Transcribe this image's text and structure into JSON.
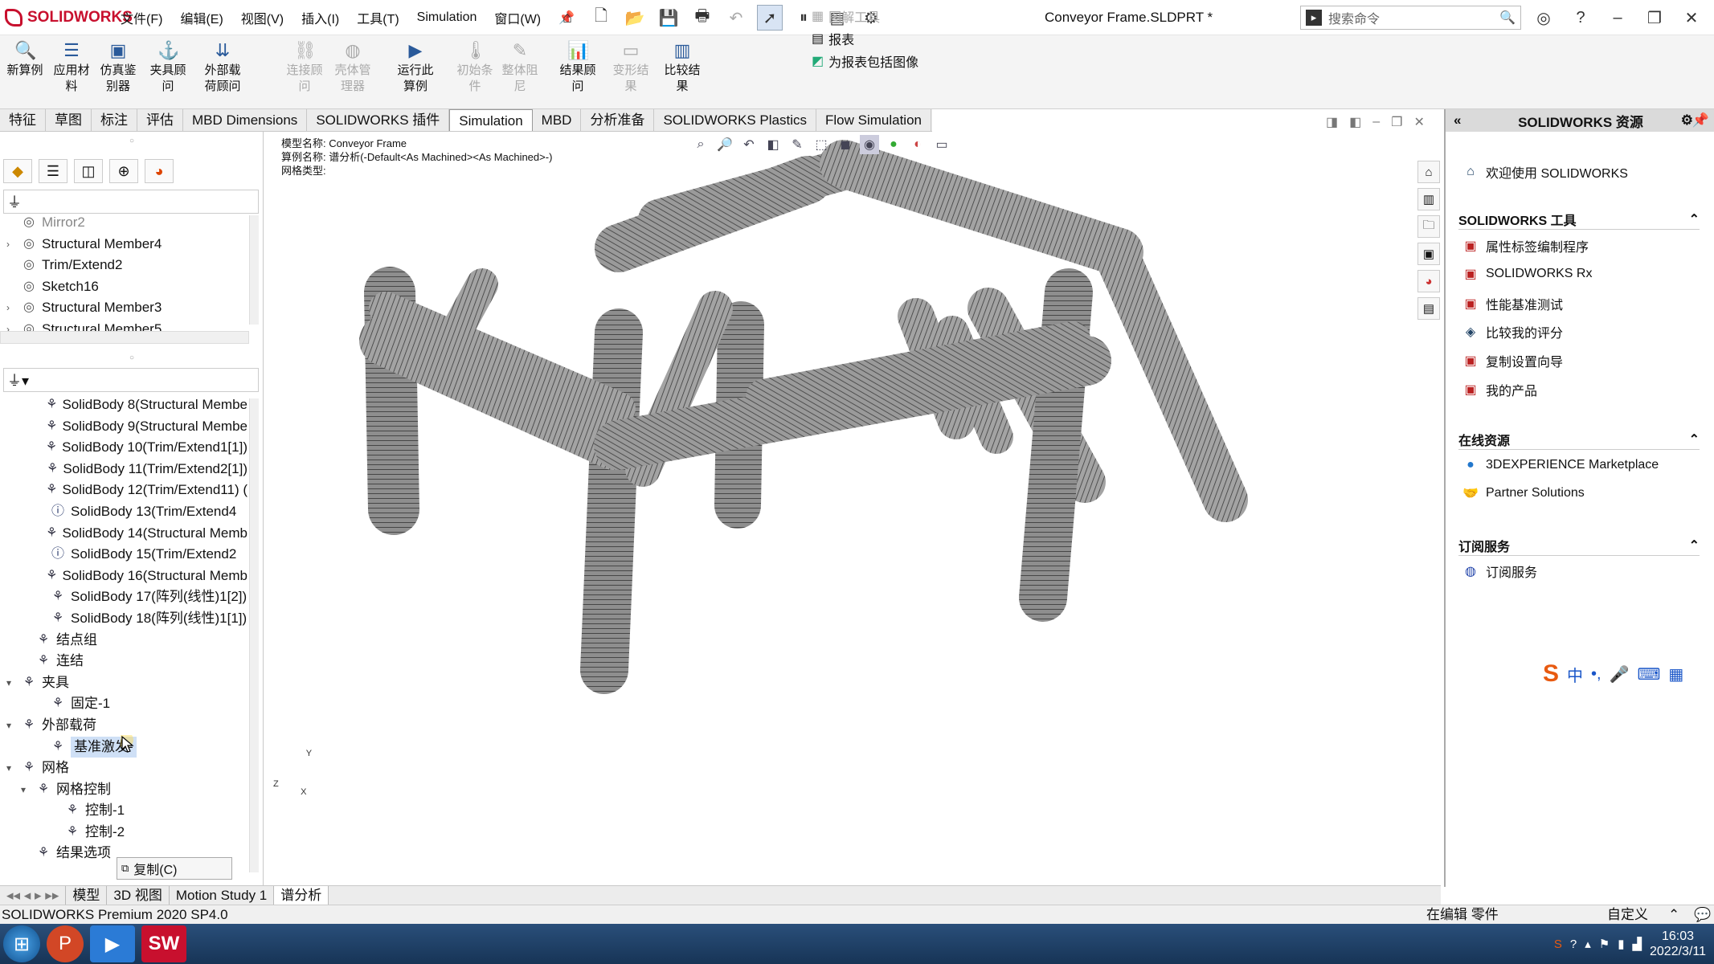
{
  "app": {
    "brand": "SOLIDWORKS",
    "doc_title": "Conveyor Frame.SLDPRT *"
  },
  "menu": [
    "文件(F)",
    "编辑(E)",
    "视图(V)",
    "插入(I)",
    "工具(T)",
    "Simulation",
    "窗口(W)"
  ],
  "search": {
    "placeholder": "搜索命令"
  },
  "ribbon": {
    "buttons": [
      {
        "label": "新算例",
        "icon": "study-icon",
        "enabled": true
      },
      {
        "label": "应用材料",
        "icon": "material-icon",
        "enabled": true
      },
      {
        "label": "仿真鉴别器",
        "icon": "evaluator-icon",
        "enabled": true
      },
      {
        "label": "夹具顾问",
        "icon": "fixture-icon",
        "enabled": true
      },
      {
        "label": "外部载荷顾问",
        "icon": "load-icon",
        "enabled": true
      },
      {
        "label": "连接顾问",
        "icon": "connection-icon",
        "enabled": false
      },
      {
        "label": "壳体管理器",
        "icon": "shell-icon",
        "enabled": false
      },
      {
        "label": "运行此算例",
        "icon": "run-icon",
        "enabled": true
      },
      {
        "label": "初始条件",
        "icon": "init-icon",
        "enabled": false
      },
      {
        "label": "整体阻尼",
        "icon": "damping-icon",
        "enabled": false
      },
      {
        "label": "结果顾问",
        "icon": "result-icon",
        "enabled": true
      },
      {
        "label": "变形结果",
        "icon": "deform-icon",
        "enabled": false
      },
      {
        "label": "比较结果",
        "icon": "compare-icon",
        "enabled": true
      }
    ],
    "small": [
      {
        "label": "图解工具",
        "enabled": false
      },
      {
        "label": "报表",
        "enabled": true
      },
      {
        "label": "为报表包括图像",
        "enabled": true
      }
    ]
  },
  "tabs": [
    "特征",
    "草图",
    "标注",
    "评估",
    "MBD Dimensions",
    "SOLIDWORKS 插件",
    "Simulation",
    "MBD",
    "分析准备",
    "SOLIDWORKS Plastics",
    "Flow Simulation"
  ],
  "active_tab": "Simulation",
  "tree_top": [
    {
      "label": "Mirror2",
      "dim": true
    },
    {
      "label": "Structural Member4",
      "expand": true
    },
    {
      "label": "Trim/Extend2"
    },
    {
      "label": "Sketch16"
    },
    {
      "label": "Structural Member3",
      "expand": true
    },
    {
      "label": "Structural Member5",
      "expand": true
    }
  ],
  "tree_sim": [
    {
      "label": "SolidBody 8(Structural Membe",
      "indent": 2
    },
    {
      "label": "SolidBody 9(Structural Membe",
      "indent": 2
    },
    {
      "label": "SolidBody 10(Trim/Extend1[1])",
      "indent": 2
    },
    {
      "label": "SolidBody 11(Trim/Extend2[1])",
      "indent": 2
    },
    {
      "label": "SolidBody 12(Trim/Extend11) (",
      "indent": 2
    },
    {
      "label": "SolidBody 13(Trim/Extend4",
      "indent": 2,
      "info": true
    },
    {
      "label": "SolidBody 14(Structural Memb",
      "indent": 2
    },
    {
      "label": "SolidBody 15(Trim/Extend2",
      "indent": 2,
      "info": true
    },
    {
      "label": "SolidBody 16(Structural Memb",
      "indent": 2
    },
    {
      "label": "SolidBody 17(阵列(线性)1[2])",
      "indent": 2
    },
    {
      "label": "SolidBody 18(阵列(线性)1[1])",
      "indent": 2
    },
    {
      "label": "结点组",
      "indent": 1
    },
    {
      "label": "连结",
      "indent": 1
    },
    {
      "label": "夹具",
      "indent": 0,
      "expand": "open"
    },
    {
      "label": "固定-1",
      "indent": 2
    },
    {
      "label": "外部载荷",
      "indent": 0,
      "expand": "open"
    },
    {
      "label": "基准激发-",
      "indent": 2,
      "selected": true
    },
    {
      "label": "网格",
      "indent": 0,
      "expand": "open"
    },
    {
      "label": "网格控制",
      "indent": 1,
      "expand": "open"
    },
    {
      "label": "控制-1",
      "indent": 3
    },
    {
      "label": "控制-2",
      "indent": 3
    },
    {
      "label": "结果选项",
      "indent": 1
    }
  ],
  "context_menu": {
    "item": "复制(C)"
  },
  "canvas_info": {
    "model": "模型名称: Conveyor Frame",
    "study": "算例名称: 谱分析(-Default<As Machined><As Machined>-)",
    "mesh": "网格类型:"
  },
  "resources": {
    "title": "SOLIDWORKS 资源",
    "welcome": "欢迎使用 SOLIDWORKS",
    "sections": [
      {
        "title": "SOLIDWORKS 工具",
        "items": [
          "属性标签编制程序",
          "SOLIDWORKS Rx",
          "性能基准测试",
          "比较我的评分",
          "复制设置向导",
          "我的产品"
        ]
      },
      {
        "title": "在线资源",
        "items": [
          "3DEXPERIENCE Marketplace",
          "Partner Solutions"
        ]
      },
      {
        "title": "订阅服务",
        "items": [
          "订阅服务"
        ]
      }
    ]
  },
  "bottom_tabs": [
    "模型",
    "3D 视图",
    "Motion Study 1",
    "谱分析"
  ],
  "status": {
    "left": "SOLIDWORKS Premium 2020 SP4.0",
    "mode": "在编辑 零件",
    "custom": "自定义"
  },
  "taskbar": {
    "time": "16:03",
    "date": "2022/3/11"
  },
  "ime": {
    "lang": "中"
  },
  "axis": {
    "x": "X",
    "y": "Y",
    "z": "Z"
  }
}
